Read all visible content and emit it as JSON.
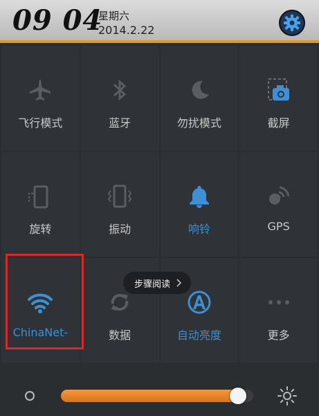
{
  "header": {
    "time": "09 04",
    "weekday": "星期六",
    "date": "2014.2.22"
  },
  "toggles": [
    {
      "label": "飞行模式",
      "icon": "airplane-icon",
      "active": false
    },
    {
      "label": "蓝牙",
      "icon": "bluetooth-icon",
      "active": false
    },
    {
      "label": "勿扰模式",
      "icon": "moon-icon",
      "active": false
    },
    {
      "label": "截屏",
      "icon": "screenshot-icon",
      "active": false
    },
    {
      "label": "旋转",
      "icon": "rotate-icon",
      "active": false
    },
    {
      "label": "振动",
      "icon": "vibrate-icon",
      "active": false
    },
    {
      "label": "响铃",
      "icon": "bell-icon",
      "active": true
    },
    {
      "label": "GPS",
      "icon": "gps-icon",
      "active": false
    },
    {
      "label": "ChinaNet-",
      "icon": "wifi-icon",
      "active": true
    },
    {
      "label": "数据",
      "icon": "data-sync-icon",
      "active": false
    },
    {
      "label": "自动亮度",
      "icon": "auto-brightness-icon",
      "active": true
    },
    {
      "label": "更多",
      "icon": "more-icon",
      "active": false
    }
  ],
  "tooltip": {
    "text": "步骤阅读"
  },
  "brightness": {
    "level": 0.92
  },
  "colors": {
    "accent": "#3e8fd4",
    "slider": "#e67a1e",
    "header_bar": "#e09a2b",
    "highlight": "#d42a2a"
  }
}
